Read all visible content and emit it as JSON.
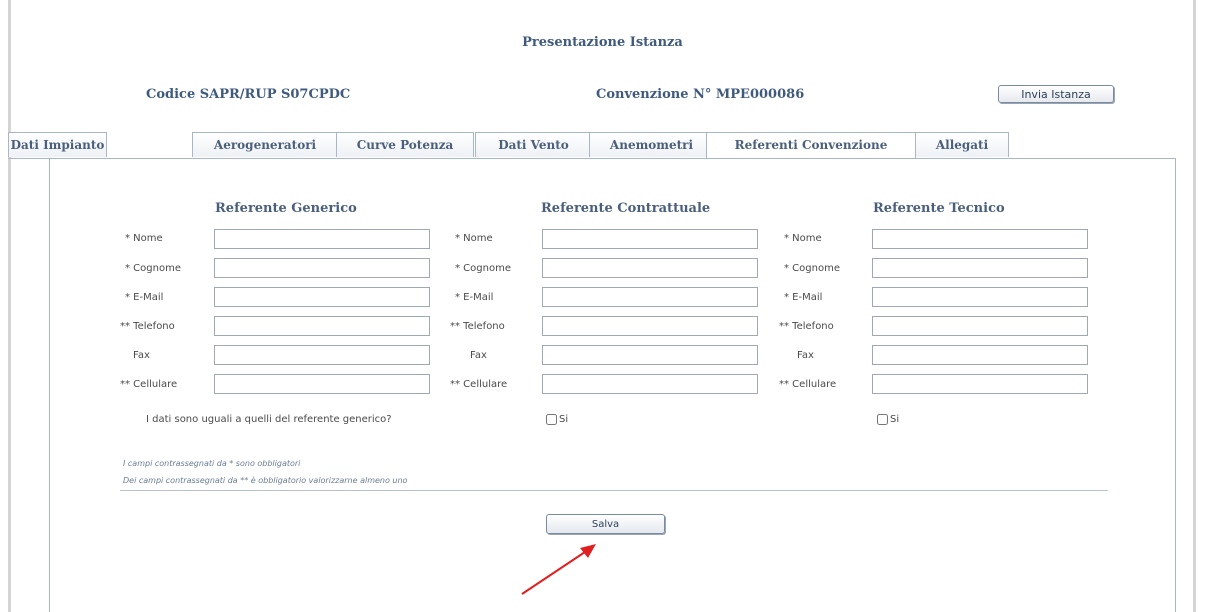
{
  "header": {
    "title": "Presentazione Istanza",
    "codice": "Codice SAPR/RUP S07CPDC",
    "convenzione": "Convenzione N° MPE000086",
    "invia_label": "Invia Istanza"
  },
  "tabs": [
    {
      "label": "Dati Impianto"
    },
    {
      "label": "Aerogeneratori"
    },
    {
      "label": "Curve Potenza"
    },
    {
      "label": "Dati Vento"
    },
    {
      "label": "Anemometri"
    },
    {
      "label": "Referenti Convenzione",
      "active": true
    },
    {
      "label": "Allegati"
    }
  ],
  "columns": [
    {
      "heading": "Referente Generico",
      "labels": {
        "nome": "* Nome",
        "cognome": "* Cognome",
        "email": "* E-Mail",
        "telefono": "** Telefono",
        "fax": "Fax",
        "cellulare": "** Cellulare"
      }
    },
    {
      "heading": "Referente Contrattuale",
      "labels": {
        "nome": "* Nome",
        "cognome": "* Cognome",
        "email": "* E-Mail",
        "telefono": "** Telefono",
        "fax": "Fax",
        "cellulare": "** Cellulare"
      }
    },
    {
      "heading": "Referente Tecnico",
      "labels": {
        "nome": "* Nome",
        "cognome": "* Cognome",
        "email": "* E-Mail",
        "telefono": "** Telefono",
        "fax": "Fax",
        "cellulare": "** Cellulare"
      }
    }
  ],
  "same_data_question": "I dati sono uguali a quelli del referente generico?",
  "checkbox_label": "Si",
  "notes": {
    "required": "I campi contrassegnati da * sono obbligatori",
    "at_least_one": "Dei campi contrassegnati da ** è obbligatorio valorizzarne almeno uno"
  },
  "save_label": "Salva",
  "colors": {
    "heading": "#4a5f7c",
    "border": "#a9b6c8",
    "annotation_arrow": "#e02020"
  }
}
